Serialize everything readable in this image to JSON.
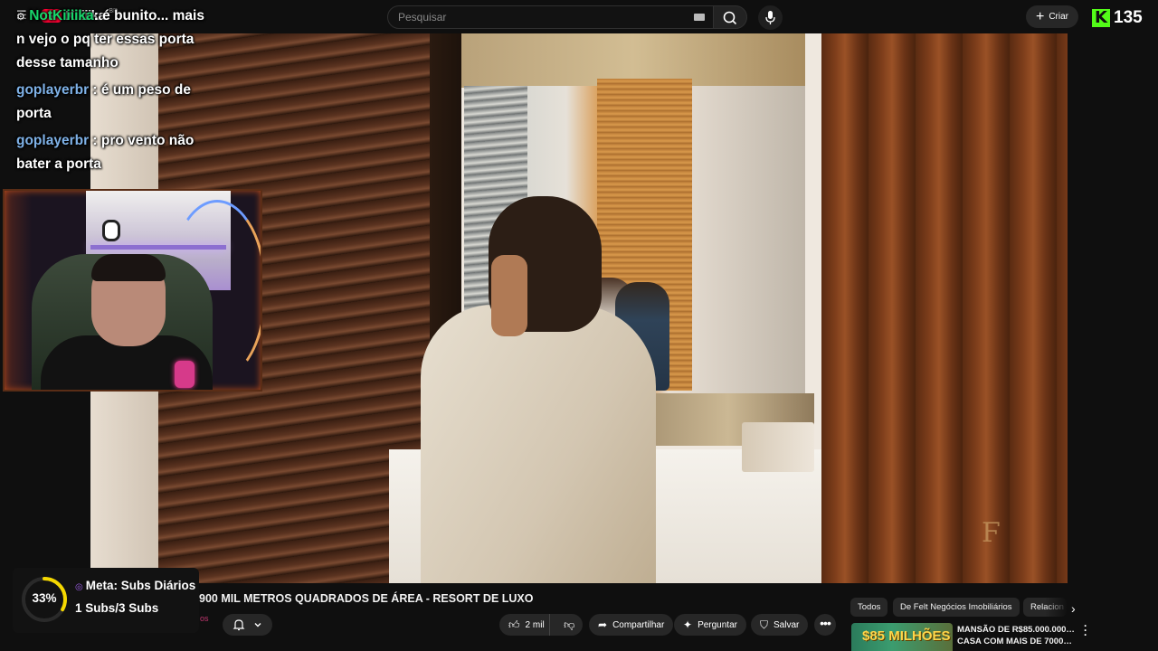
{
  "topbar": {
    "logo_text": "Kiiiiika",
    "logo_country": "BR",
    "search_placeholder": "Pesquisar",
    "create_label": "Criar",
    "kick_count": "135"
  },
  "chat": {
    "messages": [
      {
        "user": "NotKiiiika",
        "text": ": é bunito... mais n vejo o pq ter essas porta desse tamanho"
      },
      {
        "user": "goplayerbr",
        "text": " : é um peso de porta"
      },
      {
        "user": "goplayerbr",
        "text": " : pro vento não bater a porta"
      }
    ]
  },
  "goal": {
    "percent": "33%",
    "progress": 0.33,
    "title": "Meta: Subs Diários",
    "subs": "1 Subs/3 Subs",
    "accent": "#f5d800"
  },
  "video": {
    "title": "900 MIL METROS QUADRADOS DE ÁREA - RESORT DE LUXO",
    "channel_fragment": "os"
  },
  "actions": {
    "likes": "2 mil",
    "share": "Compartilhar",
    "ask": "Perguntar",
    "save": "Salvar"
  },
  "chips": [
    "Todos",
    "De Felt Negócios Imobiliários",
    "Relacion"
  ],
  "recommended": {
    "thumb_text": "$85 MILHÕES",
    "title_line1": "MANSÃO DE R$85.000.000,00",
    "title_line2": "CASA COM MAIS DE 7000M ..."
  }
}
